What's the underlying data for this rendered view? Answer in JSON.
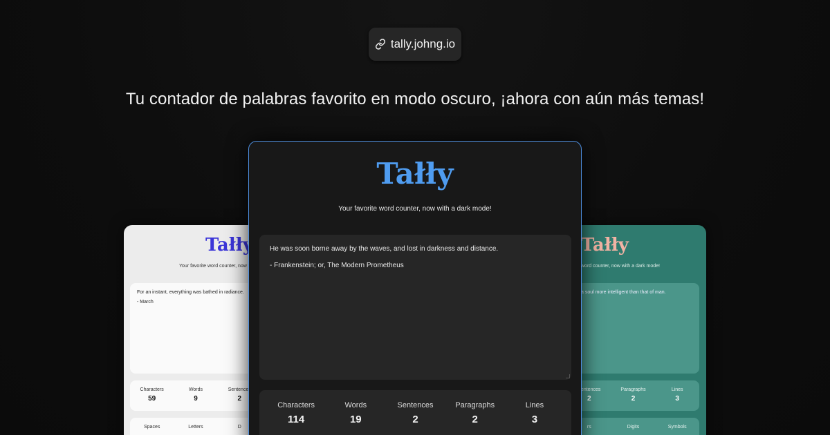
{
  "url_pill": {
    "text": "tally.johng.io",
    "icon": "link-icon"
  },
  "tagline": "Tu contador de palabras favorito en modo oscuro, ¡ahora con aún más temas!",
  "colors": {
    "background": "#0d0d0d",
    "center_accent": "#4f9cf0",
    "left_logo": "#3b35d8",
    "right_logo": "#f2b3a4",
    "right_card_bg": "#2f7b6f",
    "left_card_bg": "#ececec"
  },
  "center_card": {
    "logo": "Tałły",
    "subtitle": "Your favorite word counter, now with a dark mode!",
    "text_lines": [
      "He was soon borne away by the waves, and lost in darkness and distance.",
      "- Frankenstein; or, The Modern Prometheus"
    ],
    "stats": [
      {
        "label": "Characters",
        "value": "114"
      },
      {
        "label": "Words",
        "value": "19"
      },
      {
        "label": "Sentences",
        "value": "2"
      },
      {
        "label": "Paragraphs",
        "value": "2"
      },
      {
        "label": "Lines",
        "value": "3"
      }
    ]
  },
  "left_card": {
    "logo": "Tałły",
    "subtitle": "Your favorite word counter, now with",
    "text_lines": [
      "For an instant, everything was bathed in radiance.",
      "- March"
    ],
    "stats": [
      {
        "label": "Characters",
        "value": "59"
      },
      {
        "label": "Words",
        "value": "9"
      },
      {
        "label": "Sentences",
        "value": "2"
      }
    ],
    "stats2": [
      {
        "label": "Spaces",
        "value": ""
      },
      {
        "label": "Letters",
        "value": ""
      },
      {
        "label": "D",
        "value": ""
      }
    ]
  },
  "right_card": {
    "logo": "Tałły",
    "subtitle": "word counter, now with a dark mode!",
    "text_lines": [
      "a soul more intelligent than that of man."
    ],
    "stats": [
      {
        "label": "Sentences",
        "value": "2"
      },
      {
        "label": "Paragraphs",
        "value": "2"
      },
      {
        "label": "Lines",
        "value": "3"
      }
    ],
    "stats2": [
      {
        "label": "rs",
        "value": ""
      },
      {
        "label": "Digits",
        "value": ""
      },
      {
        "label": "Symbols",
        "value": ""
      }
    ]
  }
}
